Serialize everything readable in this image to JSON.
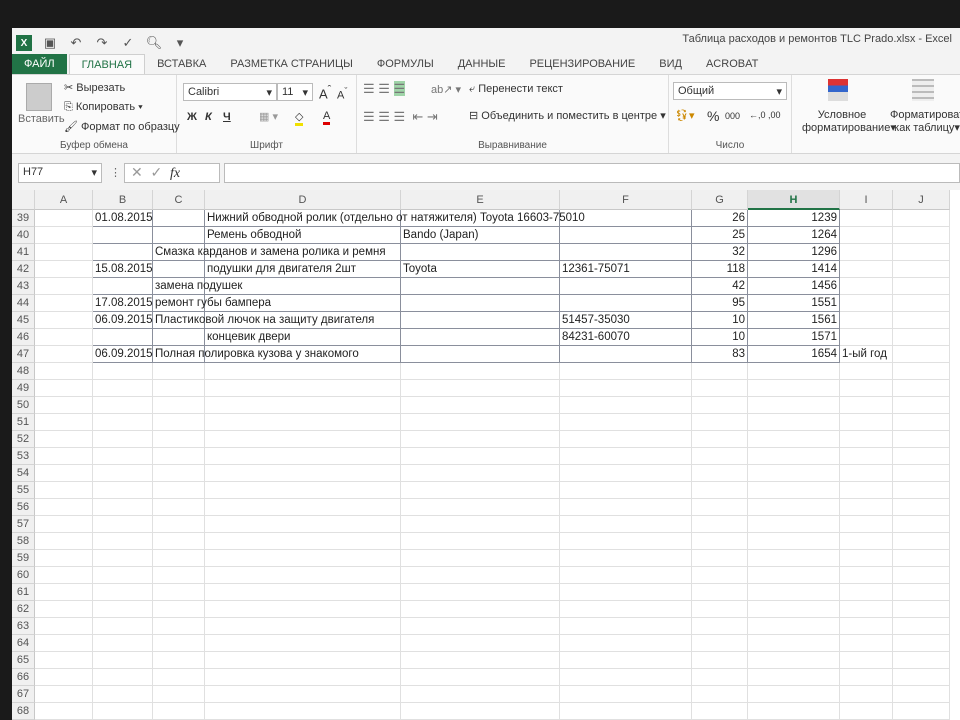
{
  "window": {
    "title": "Таблица расходов и ремонтов TLC Prado.xlsx - Excel"
  },
  "tabs": [
    "ФАЙЛ",
    "ГЛАВНАЯ",
    "ВСТАВКА",
    "РАЗМЕТКА СТРАНИЦЫ",
    "ФОРМУЛЫ",
    "ДАННЫЕ",
    "РЕЦЕНЗИРОВАНИЕ",
    "ВИД",
    "ACROBAT"
  ],
  "ribbon": {
    "clipboard": {
      "paste": "Вставить",
      "cut": "Вырезать",
      "copy": "Копировать",
      "format_painter": "Формат по образцу",
      "label": "Буфер обмена"
    },
    "font": {
      "name": "Calibri",
      "size": "11",
      "bold": "Ж",
      "italic": "К",
      "underline": "Ч",
      "label": "Шрифт"
    },
    "alignment": {
      "wrap": "Перенести текст",
      "merge": "Объединить и поместить в центре",
      "label": "Выравнивание"
    },
    "number": {
      "format": "Общий",
      "percent": "%",
      "thousands": "000",
      "label": "Число"
    },
    "styles": {
      "conditional_1": "Условное",
      "conditional_2": "форматирование",
      "table_1": "Форматироват",
      "table_2": "как таблицу"
    }
  },
  "formula_bar": {
    "name_box": "H77",
    "fx": "fx",
    "value": ""
  },
  "columns": [
    "A",
    "B",
    "C",
    "D",
    "E",
    "F",
    "G",
    "H",
    "I",
    "J"
  ],
  "selected_column": "H",
  "rows": [
    {
      "n": "39",
      "B": "01.08.2015",
      "D": "Нижний обводной ролик (отдельно от натяжителя) Toyota 16603-75010",
      "G": "26",
      "H": "1239"
    },
    {
      "n": "40",
      "D": "Ремень обводной",
      "E": "Bando (Japan)",
      "G": "25",
      "H": "1264"
    },
    {
      "n": "41",
      "C": "Смазка карданов и замена ролика и ремня",
      "G": "32",
      "H": "1296"
    },
    {
      "n": "42",
      "B": "15.08.2015",
      "D": "подушки для двигателя  2шт",
      "E": "Toyota",
      "F": "12361-75071",
      "G": "118",
      "H": "1414"
    },
    {
      "n": "43",
      "C": "замена подушек",
      "G": "42",
      "H": "1456"
    },
    {
      "n": "44",
      "B": "17.08.2015",
      "C": "ремонт губы бампера",
      "G": "95",
      "H": "1551"
    },
    {
      "n": "45",
      "B": "06.09.2015",
      "C": "Пластиковой лючок на защиту двигателя",
      "F": "51457-35030",
      "G": "10",
      "H": "1561"
    },
    {
      "n": "46",
      "D": "концевик двери",
      "F": "84231-60070",
      "G": "10",
      "H": "1571"
    },
    {
      "n": "47",
      "B": "06.09.2015",
      "C": "Полная полировка кузова у знакомого",
      "G": "83",
      "H": "1654",
      "I": "1-ый год"
    },
    {
      "n": "48"
    },
    {
      "n": "49"
    },
    {
      "n": "50"
    },
    {
      "n": "51"
    },
    {
      "n": "52"
    },
    {
      "n": "53"
    },
    {
      "n": "54"
    },
    {
      "n": "55"
    },
    {
      "n": "56"
    },
    {
      "n": "57"
    },
    {
      "n": "58"
    },
    {
      "n": "59"
    },
    {
      "n": "60"
    },
    {
      "n": "61"
    },
    {
      "n": "62"
    },
    {
      "n": "63"
    },
    {
      "n": "64"
    },
    {
      "n": "65"
    },
    {
      "n": "66"
    },
    {
      "n": "67"
    },
    {
      "n": "68"
    }
  ]
}
